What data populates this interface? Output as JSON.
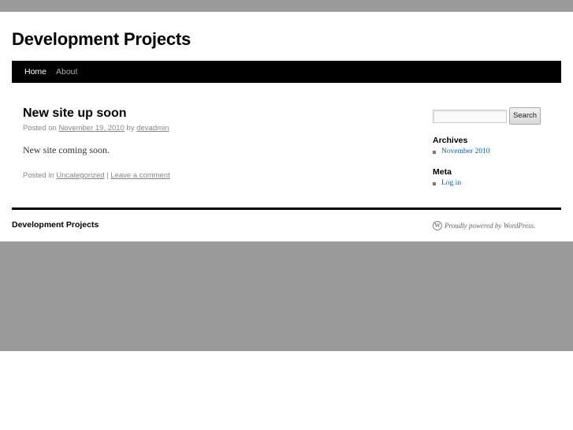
{
  "site": {
    "title": "Development Projects"
  },
  "nav": {
    "items": [
      {
        "label": "Home",
        "current": true
      },
      {
        "label": "About",
        "current": false
      }
    ]
  },
  "post": {
    "title": "New site up soon",
    "meta": {
      "posted_on": "Posted on",
      "date": "November 19, 2010",
      "by": "by",
      "author": "devadmin"
    },
    "content": "New site coming soon.",
    "utility": {
      "posted_in": "Posted in",
      "category": "Uncategorized",
      "separator": "|",
      "comment_link": "Leave a comment"
    }
  },
  "sidebar": {
    "search": {
      "placeholder": "",
      "button_label": "Search"
    },
    "widgets": [
      {
        "title": "Archives",
        "items": [
          "November 2010"
        ]
      },
      {
        "title": "Meta",
        "items": [
          "Log in"
        ]
      }
    ]
  },
  "footer": {
    "site_title": "Development Projects",
    "credit": "Proudly powered by WordPress.",
    "credit_icon": "wordpress-icon"
  },
  "colors": {
    "band": "#9a9a9a",
    "nav_bg": "#000000",
    "link": "#0066cc"
  }
}
